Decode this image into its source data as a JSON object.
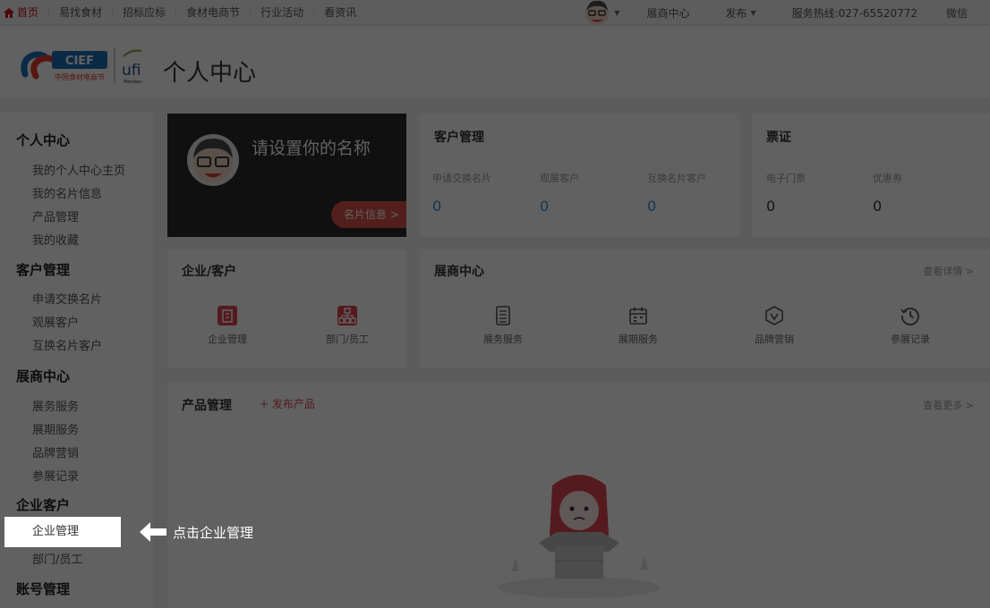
{
  "topbar": {
    "nav": [
      "首页",
      "易找食材",
      "招标应标",
      "食材电商节",
      "行业活动",
      "看资讯"
    ],
    "exhibitor_center": "展商中心",
    "publish": "发布",
    "hotline": "服务热线:027-65520772",
    "wechat": "微信"
  },
  "header": {
    "logo_text": "CIEF",
    "logo_subtext": "中国食材电商节",
    "ufi_text": "ufi",
    "ufi_member": "Member",
    "page_title": "个人中心"
  },
  "sidebar": {
    "sections": [
      {
        "title": "个人中心",
        "items": [
          "我的个人中心主页",
          "我的名片信息",
          "产品管理",
          "我的收藏"
        ]
      },
      {
        "title": "客户管理",
        "items": [
          "申请交换名片",
          "观展客户",
          "互换名片客户"
        ]
      },
      {
        "title": "展商中心",
        "items": [
          "展务服务",
          "展期服务",
          "品牌营销",
          "参展记录"
        ]
      },
      {
        "title": "企业客户",
        "items": [
          "企业管理",
          "部门/员工"
        ]
      },
      {
        "title": "账号管理",
        "items": []
      }
    ]
  },
  "profile": {
    "name_prompt": "请设置你的名称",
    "card_button": "名片信息 >"
  },
  "customer_mgmt": {
    "title": "客户管理",
    "stats": [
      {
        "label": "申请交换名片",
        "value": "0"
      },
      {
        "label": "观展客户",
        "value": "0"
      },
      {
        "label": "互换名片客户",
        "value": "0"
      }
    ]
  },
  "ticket": {
    "title": "票证",
    "stats": [
      {
        "label": "电子门票",
        "value": "0"
      },
      {
        "label": "优惠券",
        "value": "0"
      }
    ]
  },
  "enterprise": {
    "title": "企业/客户",
    "features": [
      "企业管理",
      "部门/员工"
    ]
  },
  "exhibitor": {
    "title": "展商中心",
    "more": "查看详情 >",
    "features": [
      "展务服务",
      "展期服务",
      "品牌营销",
      "参展记录"
    ]
  },
  "product": {
    "title": "产品管理",
    "publish": "+ 发布产品",
    "more": "查看更多 >"
  },
  "guide": {
    "highlight_label": "企业管理",
    "hint_text": "点击企业管理"
  },
  "colors": {
    "brand_red": "#c8161d",
    "accent_blue": "#3b8ed8",
    "profile_dark": "#2b2b2f",
    "button_red": "#d8524a"
  }
}
